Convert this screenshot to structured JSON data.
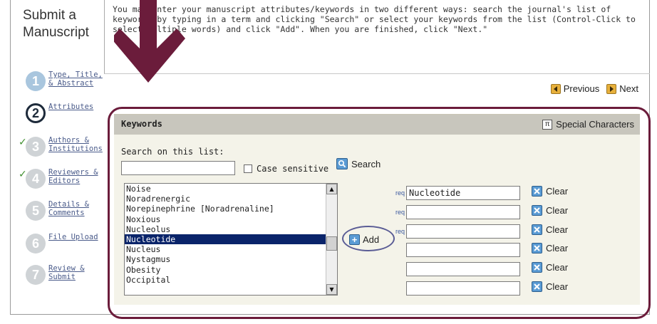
{
  "page": {
    "title": "Submit a Manuscript",
    "instructions": "You may enter your manuscript attributes/keywords in two different ways: search the journal's list of keywords by typing in a term and clicking \"Search\" or select your keywords from the list (Control-Click to select multiple words) and click \"Add\". When you are finished, click \"Next.\""
  },
  "steps": [
    {
      "number": "1",
      "label": "Type, Title, & Abstract",
      "status": "visited"
    },
    {
      "number": "2",
      "label": "Attributes",
      "status": "current"
    },
    {
      "number": "3",
      "label": "Authors & Institutions",
      "status": "done"
    },
    {
      "number": "4",
      "label": "Reviewers & Editors",
      "status": "done"
    },
    {
      "number": "5",
      "label": "Details & Comments",
      "status": "pending"
    },
    {
      "number": "6",
      "label": "File Upload",
      "status": "pending"
    },
    {
      "number": "7",
      "label": "Review & Submit",
      "status": "pending"
    }
  ],
  "nav": {
    "previous_label": "Previous",
    "next_label": "Next",
    "icon": "arrow-button-icon",
    "color": "#e7b03b"
  },
  "keywords_panel": {
    "title": "Keywords",
    "special_characters_label": "Special Characters",
    "search_label": "Search on this list:",
    "search_value": "",
    "case_sensitive_label": "Case sensitive",
    "case_sensitive_checked": false,
    "search_button_label": "Search",
    "add_button_label": "Add",
    "list_items": [
      "Noise",
      "Noradrenergic",
      "Norepinephrine [Noradrenaline]",
      "Noxious",
      "Nucleolus",
      "Nucleotide",
      "Nucleus",
      "Nystagmus",
      "Obesity",
      "Occipital"
    ],
    "selected_item": "Nucleotide",
    "keyword_fields": [
      {
        "required": true,
        "req_label": "req",
        "value": "Nucleotide",
        "clear_label": "Clear"
      },
      {
        "required": true,
        "req_label": "req",
        "value": "",
        "clear_label": "Clear"
      },
      {
        "required": true,
        "req_label": "req",
        "value": "",
        "clear_label": "Clear"
      },
      {
        "required": false,
        "req_label": "",
        "value": "",
        "clear_label": "Clear"
      },
      {
        "required": false,
        "req_label": "",
        "value": "",
        "clear_label": "Clear"
      },
      {
        "required": false,
        "req_label": "",
        "value": "",
        "clear_label": "Clear"
      }
    ]
  },
  "colors": {
    "highlight": "#6b1c3b",
    "arrow": "#6b1c3b",
    "selection": "#0a246a",
    "panel_background": "#f4f3e9",
    "panel_header": "#c8c6bd"
  }
}
